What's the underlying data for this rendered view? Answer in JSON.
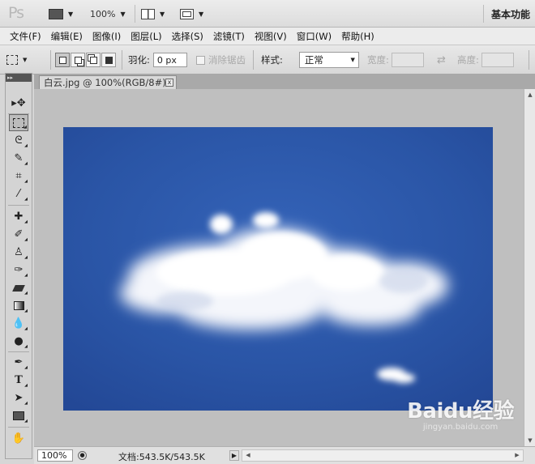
{
  "appbar": {
    "logo": "Ps",
    "zoom": "100%",
    "workspace": "基本功能"
  },
  "menu": [
    "文件(F)",
    "编辑(E)",
    "图像(I)",
    "图层(L)",
    "选择(S)",
    "滤镜(T)",
    "视图(V)",
    "窗口(W)",
    "帮助(H)"
  ],
  "options": {
    "feather_label": "羽化:",
    "feather_value": "0 px",
    "antialias_label": "消除锯齿",
    "style_label": "样式:",
    "style_value": "正常",
    "width_label": "宽度:",
    "height_label": "高度:"
  },
  "document": {
    "tab_title": "白云.jpg @ 100%(RGB/8#)",
    "close_glyph": "x"
  },
  "status": {
    "zoom": "100%",
    "doc_info": "文档:543.5K/543.5K"
  },
  "watermark": {
    "brand": "Baidu经验",
    "url": "jingyan.baidu.com"
  },
  "icons": [
    "marquee-tool-icon",
    "lasso-icon",
    "quick-select-icon",
    "crop-icon",
    "eyedropper-icon",
    "healing-brush-icon",
    "brush-icon",
    "clone-stamp-icon",
    "history-brush-icon",
    "eraser-icon",
    "gradient-icon",
    "blur-icon",
    "dodge-icon",
    "pen-icon",
    "type-icon",
    "path-select-icon",
    "shape-icon",
    "hand-icon"
  ],
  "colors": {
    "sky": "#2a54a6",
    "ui_bg": "#d6d6d6"
  }
}
